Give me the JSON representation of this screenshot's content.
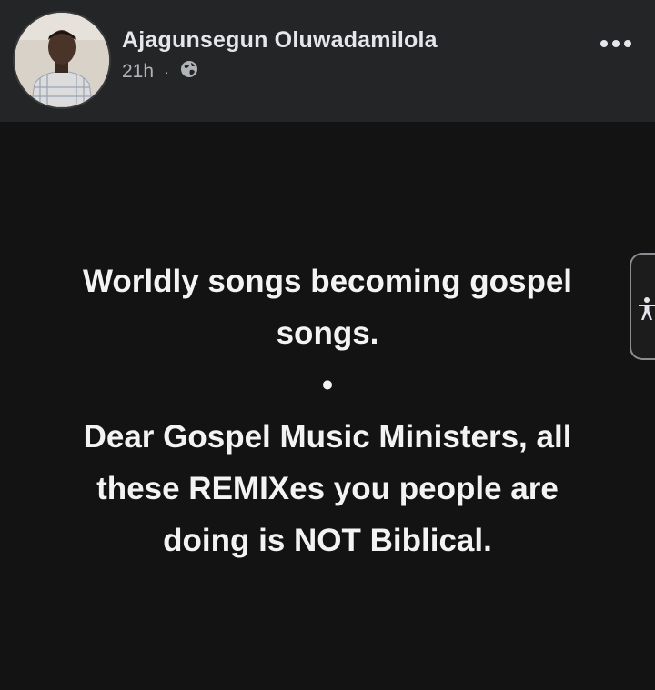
{
  "post": {
    "author": "Ajagunsegun Oluwadamilola",
    "time": "21h",
    "separator": "·",
    "privacy_icon": "globe-icon",
    "more_icon": "more-options-icon",
    "lines": [
      "Worldly songs becoming gospel",
      "songs.",
      "•",
      "Dear Gospel Music Ministers, all",
      "these REMIXes you people are",
      "doing is NOT Biblical."
    ]
  },
  "accessibility": {
    "icon": "accessibility-icon"
  },
  "colors": {
    "header_bg": "#242526",
    "post_bg": "#131313",
    "name": "#e4e6eb",
    "meta": "#b0b3b8",
    "text": "#f3f3f3"
  }
}
